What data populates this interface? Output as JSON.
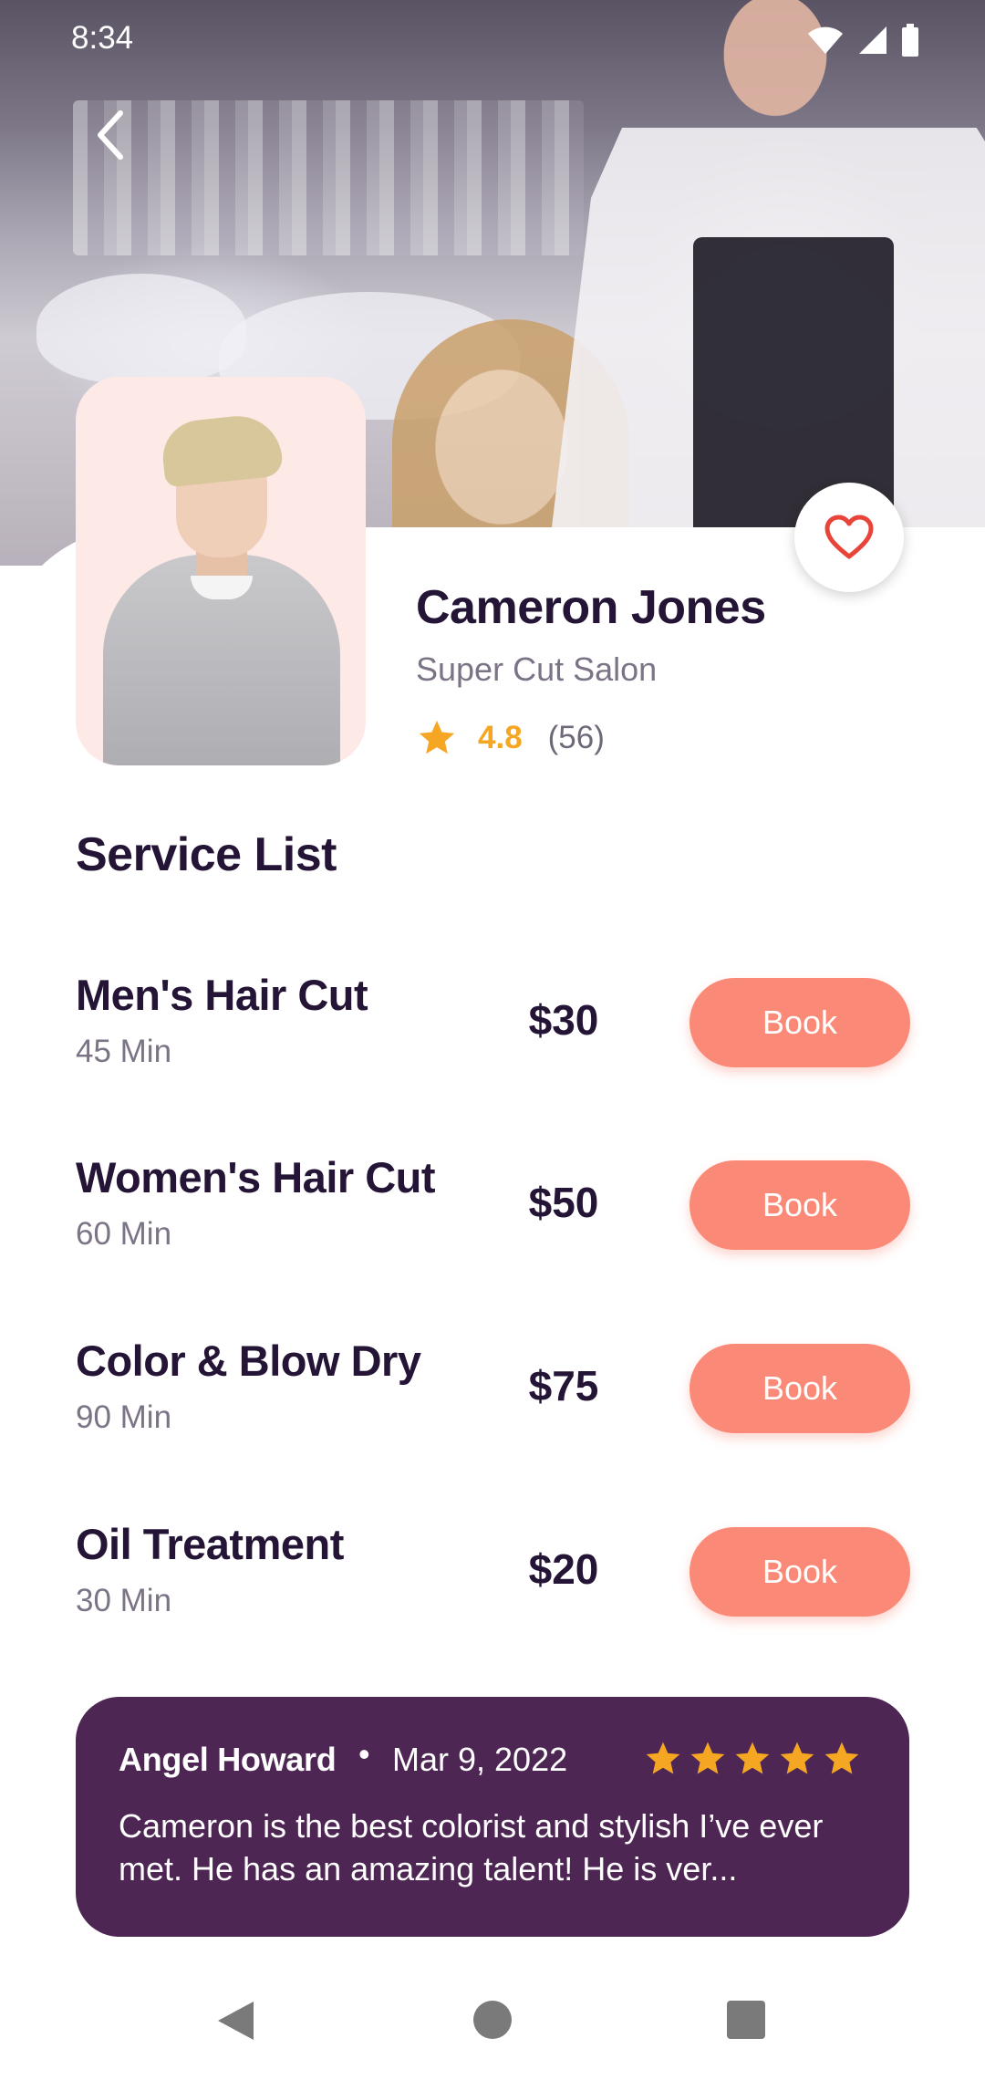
{
  "status_bar": {
    "time": "8:34",
    "icons": [
      "wifi-icon",
      "signal-icon",
      "battery-icon"
    ]
  },
  "header": {
    "back_icon": "chevron-left-icon",
    "favorite_icon": "heart-outline-icon"
  },
  "profile": {
    "name": "Cameron Jones",
    "salon": "Super Cut Salon",
    "rating": "4.8",
    "rating_count": "(56)",
    "rating_icon": "star-icon"
  },
  "services": {
    "title": "Service List",
    "items": [
      {
        "name": "Men's Hair Cut",
        "duration": "45 Min",
        "price": "$30",
        "button": "Book"
      },
      {
        "name": "Women's Hair Cut",
        "duration": "60 Min",
        "price": "$50",
        "button": "Book"
      },
      {
        "name": "Color & Blow Dry",
        "duration": "90 Min",
        "price": "$75",
        "button": "Book"
      },
      {
        "name": "Oil Treatment",
        "duration": "30 Min",
        "price": "$20",
        "button": "Book"
      }
    ]
  },
  "review": {
    "author": "Angel Howard",
    "separator": "•",
    "date": "Mar 9, 2022",
    "stars": 5,
    "text": "Cameron is the best colorist and stylish I’ve ever met. He has an amazing talent! He is ver..."
  },
  "colors": {
    "accent": "#fa8a77",
    "star": "#f5a623",
    "review_bg": "#4e2654",
    "heart": "#e8443a",
    "text": "#241435"
  },
  "nav_bar": {
    "icons": [
      "nav-back-icon",
      "nav-home-icon",
      "nav-recents-icon"
    ]
  }
}
